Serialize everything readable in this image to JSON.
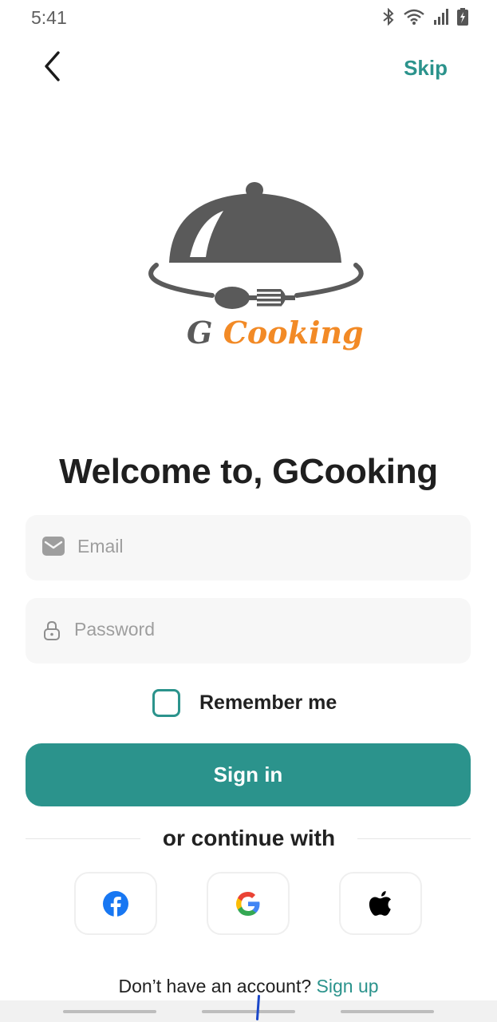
{
  "status_bar": {
    "time": "5:41",
    "icons": [
      "bluetooth-icon",
      "wifi-icon",
      "signal-icon",
      "battery-charging-icon"
    ]
  },
  "top_bar": {
    "back_icon": "chevron-left-icon",
    "skip_label": "Skip"
  },
  "logo": {
    "prefix": "G",
    "name": "Cooking",
    "colors": {
      "cloche": "#5a5a5a",
      "accent": "#f28a26"
    }
  },
  "welcome": {
    "title": "Welcome to, GCooking"
  },
  "form": {
    "email": {
      "placeholder": "Email",
      "value": "",
      "icon": "mail-icon"
    },
    "password": {
      "placeholder": "Password",
      "value": "",
      "icon": "lock-icon"
    },
    "remember_label": "Remember me",
    "remember_checked": false,
    "signin_label": "Sign in"
  },
  "divider": {
    "text": "or continue with"
  },
  "social": [
    {
      "name": "facebook",
      "icon": "facebook-icon"
    },
    {
      "name": "google",
      "icon": "google-icon"
    },
    {
      "name": "apple",
      "icon": "apple-icon"
    }
  ],
  "footer": {
    "prompt": "Don’t have an account?",
    "signup_label": "Sign up"
  },
  "colors": {
    "primary": "#2b938c",
    "field_bg": "#f7f7f7",
    "text": "#212121",
    "placeholder": "#9e9e9e"
  }
}
